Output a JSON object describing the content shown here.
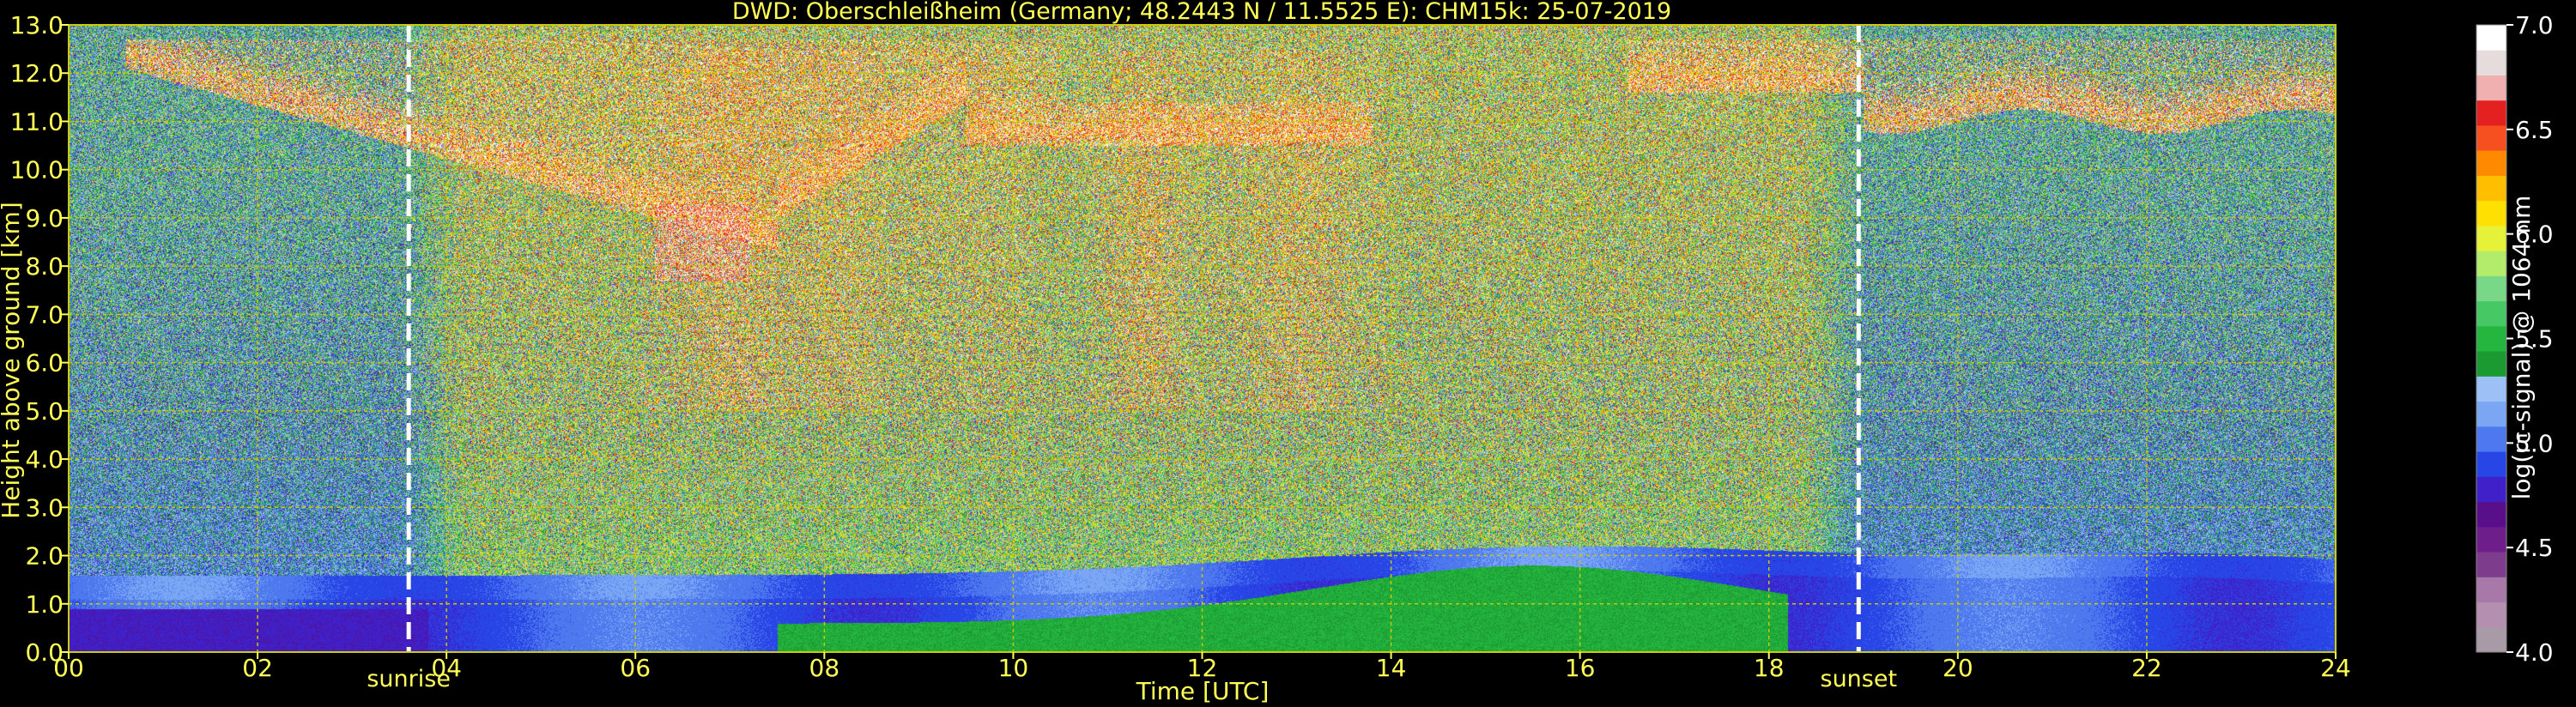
{
  "chart_data": {
    "type": "heatmap",
    "title": "DWD: Oberschleißheim (Germany; 48.2443 N / 11.5525 E):    CHM15k: 25-07-2019",
    "xlabel": "Time [UTC]",
    "ylabel": "Height above ground [km]",
    "colorbar_label": "log(rc-signal) @ 1064 nm",
    "xlim": [
      0,
      24
    ],
    "ylim": [
      0,
      13
    ],
    "x_ticks": [
      "00",
      "02",
      "04",
      "06",
      "08",
      "10",
      "12",
      "14",
      "16",
      "18",
      "20",
      "22",
      "24"
    ],
    "y_ticks": [
      "0.0",
      "1.0",
      "2.0",
      "3.0",
      "4.0",
      "5.0",
      "6.0",
      "7.0",
      "8.0",
      "9.0",
      "10.0",
      "11.0",
      "12.0",
      "13.0"
    ],
    "grid": true,
    "colorbar": {
      "range": [
        4.0,
        7.0
      ],
      "ticks": [
        "4.0",
        "4.5",
        "5.0",
        "5.5",
        "6.0",
        "6.5",
        "7.0"
      ],
      "colors": [
        "#a99aa8",
        "#b48fb0",
        "#a878a8",
        "#7d3d8c",
        "#6e1e8a",
        "#5a0f8a",
        "#4020c8",
        "#2845e6",
        "#4d78ee",
        "#7aa6f4",
        "#9dc1f6",
        "#1b9a32",
        "#25b640",
        "#46c864",
        "#79d888",
        "#b3ec6a",
        "#e6f23a",
        "#ffe000",
        "#ffbf00",
        "#ff8a00",
        "#f75020",
        "#e52020",
        "#f0b0b0",
        "#e6dcdc",
        "#ffffff"
      ]
    },
    "annotations": [
      {
        "text": "sunrise",
        "x": 3.6
      },
      {
        "text": "sunset",
        "x": 18.95
      }
    ],
    "colors": {
      "text": "#ffff55",
      "grid": "#c8c800",
      "marker": "#ffffff",
      "background": "#000000"
    }
  }
}
